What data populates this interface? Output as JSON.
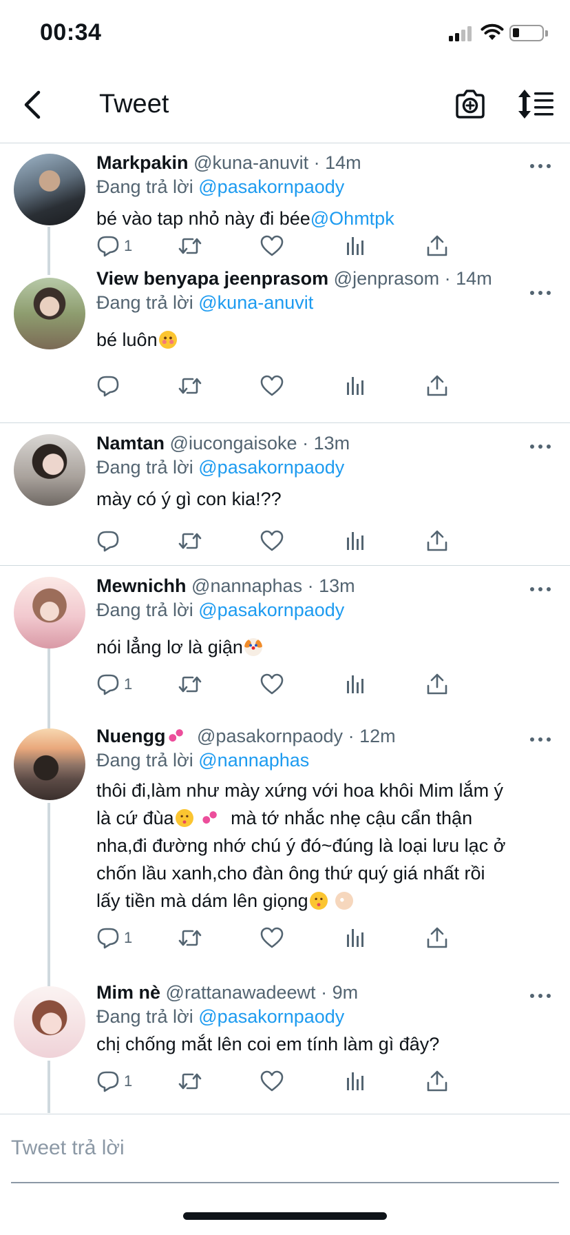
{
  "status_bar": {
    "time": "00:34"
  },
  "nav": {
    "title": "Tweet"
  },
  "colors": {
    "accent": "#1d9bf0",
    "muted": "#536471",
    "divider": "#cfd9de"
  },
  "tweets": [
    {
      "name": "Markpakin",
      "handle": "@kuna-anuvit",
      "time": "· 14m",
      "replying_prefix": "Đang trả lời ",
      "replying_to": "@pasakornpaody",
      "text_lines": [
        "bé vào tap nhỏ này đi bée"
      ],
      "text_mention": "@Ohmtpk",
      "reply_count": "1"
    },
    {
      "name": "View benyapa jeenprasom",
      "handle": "@jenprasom",
      "time": "· 14m",
      "replying_prefix": "Đang trả lời ",
      "replying_to": "@kuna-anuvit",
      "text_lines": [
        "bé luôn"
      ],
      "emoji": "smiling-hearts-emoji",
      "reply_count": ""
    },
    {
      "name": "Namtan",
      "handle": "@iucongaisoke",
      "time": "· 13m",
      "replying_prefix": "Đang trả lời ",
      "replying_to": "@pasakornpaody",
      "text_lines": [
        "mày có ý gì con kia!??"
      ],
      "reply_count": ""
    },
    {
      "name": "Mewnichh",
      "handle": "@nannaphas",
      "time": "· 13m",
      "replying_prefix": "Đang trả lời ",
      "replying_to": "@pasakornpaody",
      "text_lines": [
        "nói lẳng lơ là giận"
      ],
      "emoji": "clown-face-emoji",
      "reply_count": "1"
    },
    {
      "name": "Nuengg",
      "name_emoji": "two-hearts-emoji",
      "handle": "@pasakornpaody",
      "time": "· 12m",
      "replying_prefix": "Đang trả lời ",
      "replying_to": "@nannaphas",
      "text_lines": [
        "thôi đi,làm như mày xứng với hoa khôi Mim lắm ý",
        "là cứ đùa",
        "  mà tớ nhắc nhẹ cậu cẩn thận",
        "nha,đi đường nhớ chú ý đó~đúng là loại lưu lạc ở",
        "chốn lầu xanh,cho đàn ông thứ quý giá nhất rồi",
        "lấy tiền mà dám lên giọng"
      ],
      "reply_count": "1"
    },
    {
      "name": "Mim nè",
      "handle": "@rattanawadeewt",
      "time": "· 9m",
      "replying_prefix": "Đang trả lời ",
      "replying_to": "@pasakornpaody",
      "text_lines": [
        "chị chống mắt lên coi em tính làm gì đây?"
      ],
      "reply_count": "1"
    }
  ],
  "composer": {
    "placeholder": "Tweet trả lời"
  }
}
